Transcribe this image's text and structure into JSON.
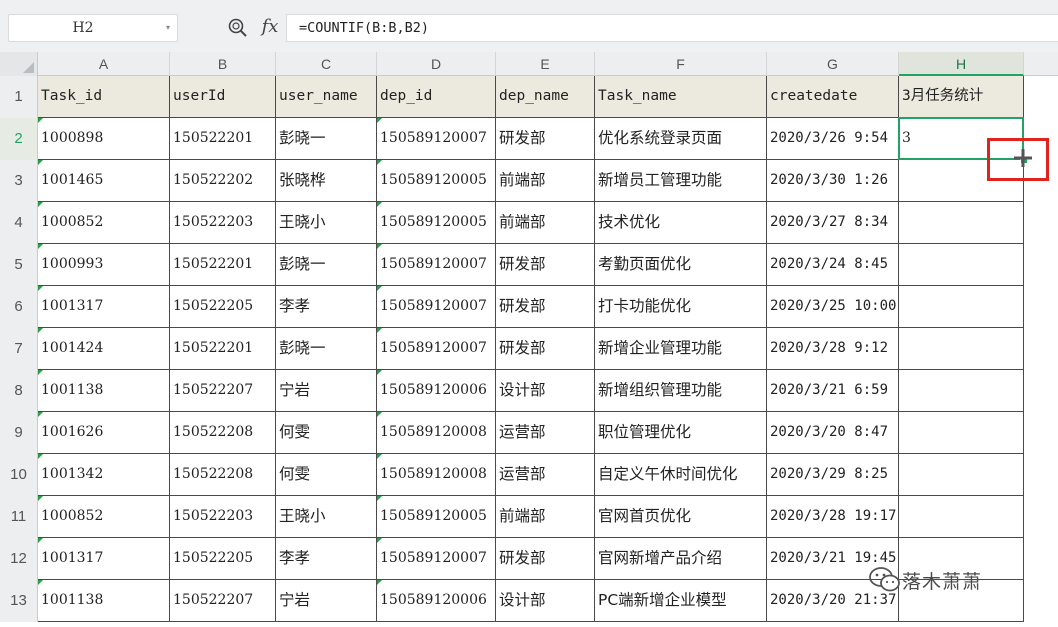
{
  "formula_bar": {
    "cell_reference": "H2",
    "fx_label": "fx",
    "formula": "=COUNTIF(B:B,B2)"
  },
  "columns": [
    "A",
    "B",
    "C",
    "D",
    "E",
    "F",
    "G",
    "H"
  ],
  "rows": [
    "1",
    "2",
    "3",
    "4",
    "5",
    "6",
    "7",
    "8",
    "9",
    "10",
    "11",
    "12",
    "13"
  ],
  "selected": {
    "column": "H",
    "row": "2"
  },
  "table": {
    "headers": [
      "Task_id",
      "userId",
      "user_name",
      "dep_id",
      "dep_name",
      "Task_name",
      "createdate",
      "3月任务统计"
    ],
    "data": [
      [
        "1000898",
        "150522201",
        "彭晓一",
        "150589120007",
        "研发部",
        "优化系统登录页面",
        "2020/3/26 9:54",
        "3"
      ],
      [
        "1001465",
        "150522202",
        "张晓桦",
        "150589120005",
        "前端部",
        "新增员工管理功能",
        "2020/3/30 1:26",
        ""
      ],
      [
        "1000852",
        "150522203",
        "王晓小",
        "150589120005",
        "前端部",
        "技术优化",
        "2020/3/27 8:34",
        ""
      ],
      [
        "1000993",
        "150522201",
        "彭晓一",
        "150589120007",
        "研发部",
        "考勤页面优化",
        "2020/3/24 8:45",
        ""
      ],
      [
        "1001317",
        "150522205",
        "李孝",
        "150589120007",
        "研发部",
        "打卡功能优化",
        "2020/3/25 10:00",
        ""
      ],
      [
        "1001424",
        "150522201",
        "彭晓一",
        "150589120007",
        "研发部",
        "新增企业管理功能",
        "2020/3/28 9:12",
        ""
      ],
      [
        "1001138",
        "150522207",
        "宁岩",
        "150589120006",
        "设计部",
        "新增组织管理功能",
        "2020/3/21 6:59",
        ""
      ],
      [
        "1001626",
        "150522208",
        "何雯",
        "150589120008",
        "运营部",
        "职位管理优化",
        "2020/3/20 8:47",
        ""
      ],
      [
        "1001342",
        "150522208",
        "何雯",
        "150589120008",
        "运营部",
        "自定义午休时间优化",
        "2020/3/29 8:25",
        ""
      ],
      [
        "1000852",
        "150522203",
        "王晓小",
        "150589120005",
        "前端部",
        "官网首页优化",
        "2020/3/28 19:17",
        ""
      ],
      [
        "1001317",
        "150522205",
        "李孝",
        "150589120007",
        "研发部",
        "官网新增产品介绍",
        "2020/3/21 19:45",
        ""
      ],
      [
        "1001138",
        "150522207",
        "宁岩",
        "150589120006",
        "设计部",
        "PC端新增企业模型",
        "2020/3/20 21:37",
        ""
      ]
    ]
  },
  "watermark": "落木萧萧",
  "colors": {
    "accent_green": "#21a366",
    "header_fill": "#eceade",
    "highlight_red": "#e0241b"
  },
  "icons": {
    "zoom": "zoom-formula-icon",
    "fx": "fx-icon",
    "fill_cursor": "plus-cursor-icon",
    "watermark_logo": "wechat-logo"
  }
}
